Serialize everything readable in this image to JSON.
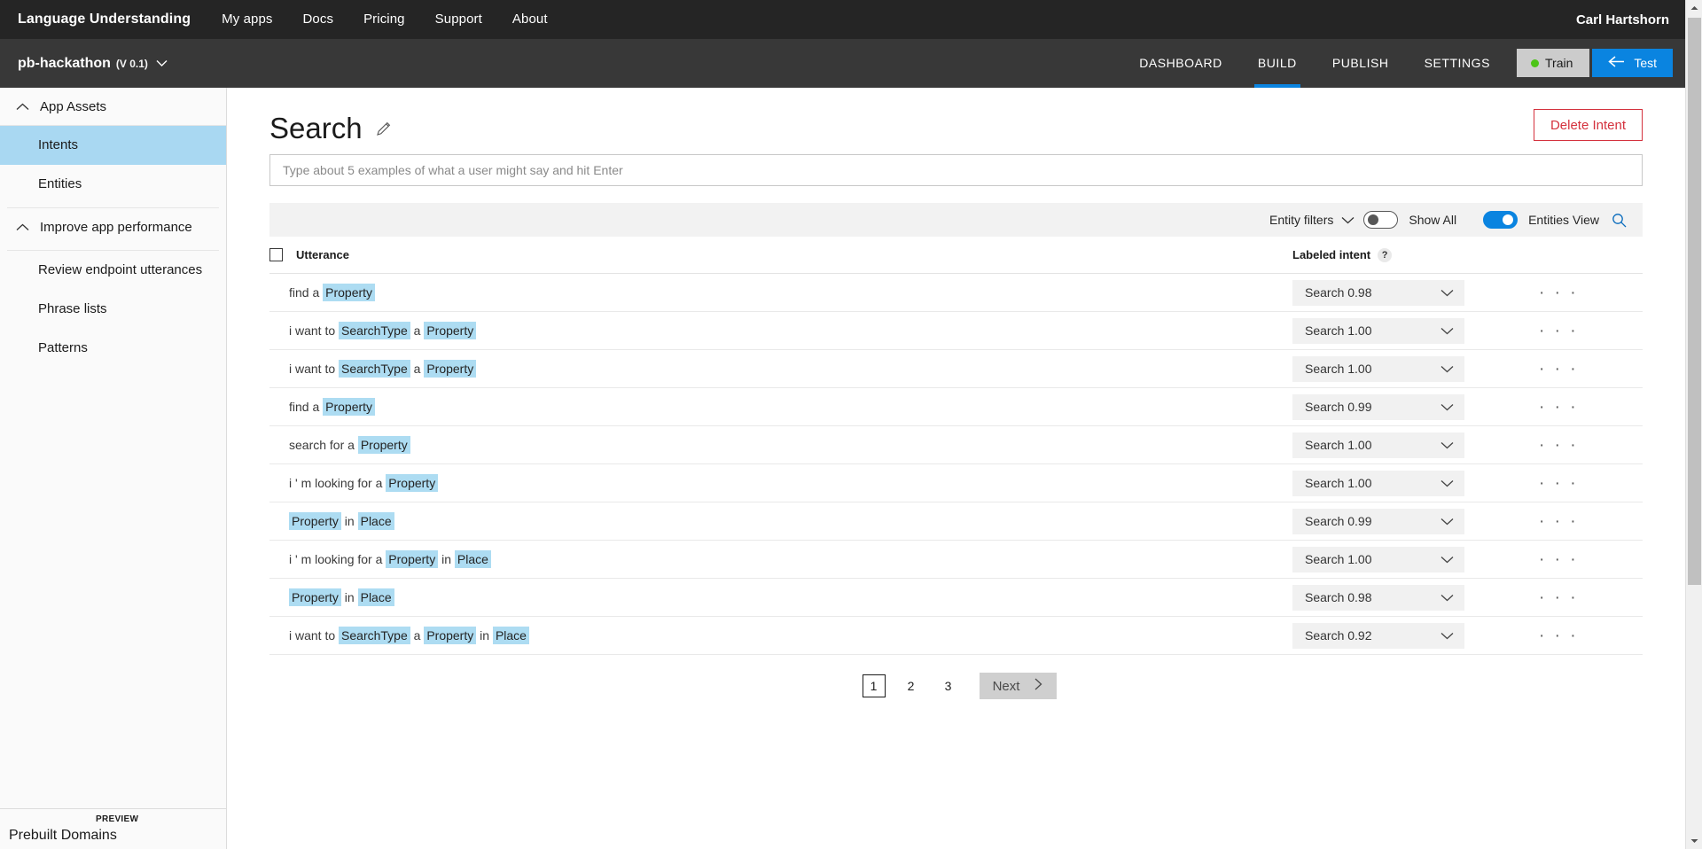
{
  "topbar": {
    "brand": "Language Understanding",
    "links": [
      "My apps",
      "Docs",
      "Pricing",
      "Support",
      "About"
    ],
    "user": "Carl Hartshorn"
  },
  "appbar": {
    "app_name": "pb-hackathon",
    "app_version": "(V 0.1)",
    "chevron": "⌄",
    "tabs": [
      "DASHBOARD",
      "BUILD",
      "PUBLISH",
      "SETTINGS"
    ],
    "active_tab": "BUILD",
    "train_label": "Train",
    "test_label": "Test",
    "train_status_color": "#4cc417",
    "test_button_color": "#0a84e0"
  },
  "sidebar": {
    "groups": [
      {
        "label": "App Assets",
        "caret": "⌃"
      },
      {
        "label": "Improve app performance",
        "caret": "⌃"
      }
    ],
    "assets_items": [
      {
        "label": "Intents",
        "selected": true
      },
      {
        "label": "Entities",
        "selected": false
      }
    ],
    "performance_items": [
      {
        "label": "Review endpoint utterances"
      },
      {
        "label": "Phrase lists"
      },
      {
        "label": "Patterns"
      }
    ],
    "bottom": {
      "label": "Prebuilt Domains",
      "tag": "PREVIEW"
    },
    "selected_color": "#a9d8f2"
  },
  "page": {
    "title": "Search",
    "edit_icon": "pencil",
    "delete_button": "Delete Intent",
    "delete_color": "#d4313d",
    "utterance_placeholder": "Type about 5 examples of what a user might say and hit Enter",
    "utterance_value": ""
  },
  "toolbar": {
    "entity_filters_label": "Entity filters",
    "show_all_label": "Show All",
    "show_all_on": false,
    "entities_view_label": "Entities View",
    "entities_view_on": true,
    "search_icon": "search-icon"
  },
  "table": {
    "columns": {
      "utterance": "Utterance",
      "labeled_intent": "Labeled intent",
      "help": "?"
    },
    "entity_highlight_color": "#addcf2",
    "rows": [
      {
        "tokens": [
          {
            "text": "find a ",
            "entity": false
          },
          {
            "text": "Property",
            "entity": true
          }
        ],
        "intent": "Search 0.98"
      },
      {
        "tokens": [
          {
            "text": "i want to ",
            "entity": false
          },
          {
            "text": "SearchType",
            "entity": true
          },
          {
            "text": " a ",
            "entity": false
          },
          {
            "text": "Property",
            "entity": true
          }
        ],
        "intent": "Search 1.00"
      },
      {
        "tokens": [
          {
            "text": "i want to ",
            "entity": false
          },
          {
            "text": "SearchType",
            "entity": true
          },
          {
            "text": " a ",
            "entity": false
          },
          {
            "text": "Property",
            "entity": true
          }
        ],
        "intent": "Search 1.00"
      },
      {
        "tokens": [
          {
            "text": "find a ",
            "entity": false
          },
          {
            "text": "Property",
            "entity": true
          }
        ],
        "intent": "Search 0.99"
      },
      {
        "tokens": [
          {
            "text": "search for a ",
            "entity": false
          },
          {
            "text": "Property",
            "entity": true
          }
        ],
        "intent": "Search 1.00"
      },
      {
        "tokens": [
          {
            "text": "i ' m looking for a ",
            "entity": false
          },
          {
            "text": "Property",
            "entity": true
          }
        ],
        "intent": "Search 1.00"
      },
      {
        "tokens": [
          {
            "text": "Property",
            "entity": true
          },
          {
            "text": " in ",
            "entity": false
          },
          {
            "text": "Place",
            "entity": true
          }
        ],
        "intent": "Search 0.99"
      },
      {
        "tokens": [
          {
            "text": "i ' m looking for a ",
            "entity": false
          },
          {
            "text": "Property",
            "entity": true
          },
          {
            "text": " in ",
            "entity": false
          },
          {
            "text": "Place",
            "entity": true
          }
        ],
        "intent": "Search 1.00"
      },
      {
        "tokens": [
          {
            "text": "Property",
            "entity": true
          },
          {
            "text": " in ",
            "entity": false
          },
          {
            "text": "Place",
            "entity": true
          }
        ],
        "intent": "Search 0.98"
      },
      {
        "tokens": [
          {
            "text": "i want to ",
            "entity": false
          },
          {
            "text": "SearchType",
            "entity": true
          },
          {
            "text": " a ",
            "entity": false
          },
          {
            "text": "Property",
            "entity": true
          },
          {
            "text": " in ",
            "entity": false
          },
          {
            "text": "Place",
            "entity": true
          }
        ],
        "intent": "Search 0.92"
      }
    ],
    "row_menu": "· · ·"
  },
  "pagination": {
    "pages": [
      "1",
      "2",
      "3"
    ],
    "current": "1",
    "next_label": "Next",
    "next_chevron": "›"
  }
}
